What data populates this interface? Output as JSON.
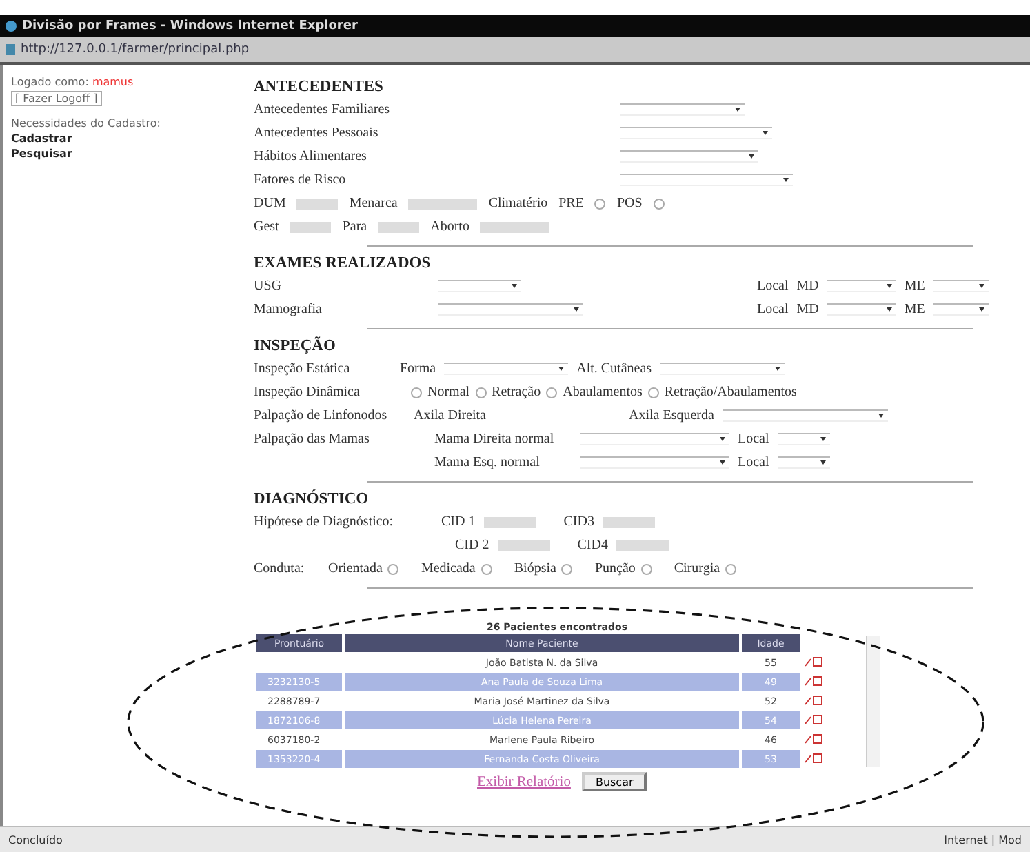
{
  "window": {
    "title": "Divisão por Frames - Windows Internet Explorer",
    "address": "http://127.0.0.1/farmer/principal.php"
  },
  "sidebar": {
    "logged_label": "Logado como:",
    "user": "mamus",
    "logoff": "[ Fazer Logoff ]",
    "heading": "Necessidades do Cadastro:",
    "links": [
      "Cadastrar",
      "Pesquisar"
    ]
  },
  "antecedentes": {
    "title": "ANTECEDENTES",
    "selects": [
      "Antecedentes Familiares",
      "Antecedentes Pessoais",
      "Hábitos Alimentares",
      "Fatores de Risco"
    ],
    "row1": [
      {
        "kind": "field",
        "label": "DUM"
      },
      {
        "kind": "field",
        "label": "Menarca"
      },
      {
        "kind": "label",
        "label": "Climatério"
      },
      {
        "kind": "radio",
        "label": "PRE",
        "selected": false
      },
      {
        "kind": "radio",
        "label": "POS",
        "selected": false
      }
    ],
    "row2": [
      {
        "kind": "field",
        "label": "Gest"
      },
      {
        "kind": "field",
        "label": "Para"
      },
      {
        "kind": "field",
        "label": "Aborto"
      }
    ]
  },
  "exames": {
    "title": "EXAMES REALIZADOS",
    "rows": [
      {
        "label": "USG",
        "local": "Local",
        "md": "MD",
        "me": "ME"
      },
      {
        "label": "Mamografia",
        "local": "Local",
        "md": "MD",
        "me": "ME"
      }
    ]
  },
  "inspecao": {
    "title": "INSPEÇÃO",
    "estatica": {
      "label": "Inspeção Estática",
      "forma": "Forma",
      "alt": "Alt. Cutâneas"
    },
    "dinamica": {
      "label": "Inspeção Dinâmica",
      "options": [
        {
          "label": "Normal",
          "selected": false
        },
        {
          "label": "Retração",
          "selected": false
        },
        {
          "label": "Abaulamentos",
          "selected": false
        },
        {
          "label": "Retração/Abaulamentos",
          "selected": false
        }
      ]
    },
    "linfonodos": {
      "label": "Palpação de Linfonodos",
      "direita": "Axila Direita",
      "esquerda": "Axila Esquerda"
    },
    "mamas": {
      "label": "Palpação das Mamas",
      "rows": [
        {
          "label": "Mama Direita normal",
          "local": "Local"
        },
        {
          "label": "Mama  Esq. normal",
          "local": "Local"
        }
      ]
    }
  },
  "diagnostico": {
    "title": "DIAGNÓSTICO",
    "hipotese": "Hipótese de Diagnóstico:",
    "cids": [
      "CID 1",
      "CID3",
      "CID 2",
      "CID4"
    ],
    "conduta": {
      "label": "Conduta:",
      "options": [
        {
          "label": "Orientada",
          "selected": false
        },
        {
          "label": "Medicada",
          "selected": false
        },
        {
          "label": "Biópsia",
          "selected": false
        },
        {
          "label": "Punção",
          "selected": false
        },
        {
          "label": "Cirurgia",
          "selected": false
        }
      ]
    }
  },
  "results": {
    "caption": "26 Pacientes encontrados",
    "columns": [
      "Prontuário",
      "Nome Paciente",
      "Idade"
    ],
    "rows": [
      {
        "id": "",
        "name": "João Batista N. da Silva",
        "age": "55",
        "selected": false
      },
      {
        "id": "3232130-5",
        "name": "Ana Paula de Souza Lima",
        "age": "49",
        "selected": true
      },
      {
        "id": "2288789-7",
        "name": "Maria José Martinez da Silva",
        "age": "52",
        "selected": false
      },
      {
        "id": "1872106-8",
        "name": "Lúcia Helena Pereira",
        "age": "54",
        "selected": true
      },
      {
        "id": "6037180-2",
        "name": "Marlene Paula Ribeiro",
        "age": "46",
        "selected": false
      },
      {
        "id": "1353220-4",
        "name": "Fernanda Costa Oliveira",
        "age": "53",
        "selected": true
      }
    ],
    "report_link": "Exibir Relatório",
    "search_button": "Buscar"
  },
  "status_bar": {
    "text": "Concluído",
    "zone": "Internet | Mod"
  }
}
